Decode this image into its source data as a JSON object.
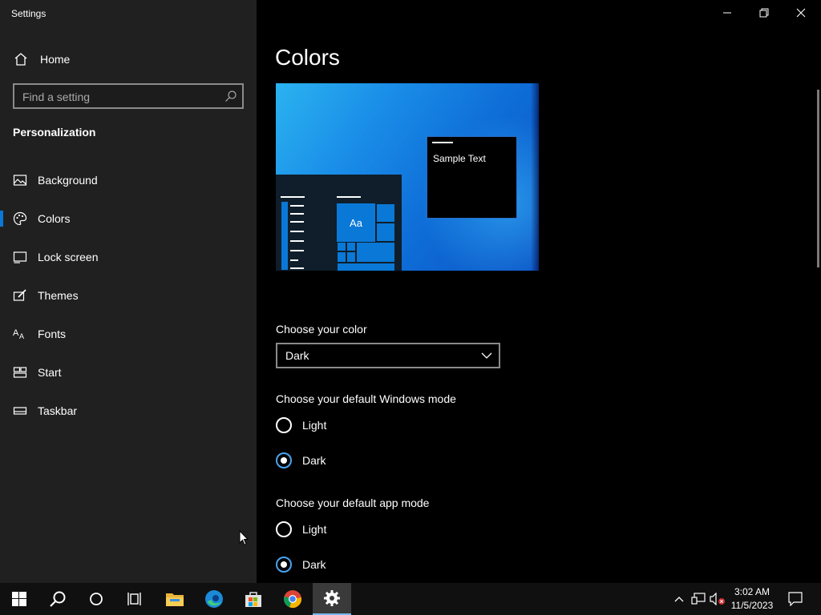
{
  "app": {
    "title": "Settings"
  },
  "sidebar": {
    "home_label": "Home",
    "search_placeholder": "Find a setting",
    "section_title": "Personalization",
    "items": [
      {
        "label": "Background",
        "icon": "image-icon"
      },
      {
        "label": "Colors",
        "icon": "palette-icon",
        "selected": true
      },
      {
        "label": "Lock screen",
        "icon": "lock-screen-icon"
      },
      {
        "label": "Themes",
        "icon": "brush-icon"
      },
      {
        "label": "Fonts",
        "icon": "font-icon"
      },
      {
        "label": "Start",
        "icon": "start-icon"
      },
      {
        "label": "Taskbar",
        "icon": "taskbar-icon"
      }
    ]
  },
  "main": {
    "title": "Colors",
    "preview": {
      "sample_text": "Sample Text",
      "tile_text": "Aa"
    },
    "choose_color": {
      "label": "Choose your color",
      "value": "Dark"
    },
    "windows_mode": {
      "label": "Choose your default Windows mode",
      "options": [
        {
          "label": "Light",
          "checked": false
        },
        {
          "label": "Dark",
          "checked": true
        }
      ]
    },
    "app_mode": {
      "label": "Choose your default app mode",
      "options": [
        {
          "label": "Light",
          "checked": false
        },
        {
          "label": "Dark",
          "checked": true
        }
      ]
    }
  },
  "taskbar": {
    "apps": [
      "start-icon",
      "search-icon",
      "cortana-icon",
      "task-view-icon",
      "file-explorer-icon",
      "edge-icon",
      "store-icon",
      "chrome-icon",
      "settings-icon"
    ],
    "clock": {
      "time": "3:02 AM",
      "date": "11/5/2023"
    }
  },
  "colors": {
    "accent": "#0a78d7",
    "sidebar_bg": "#202020",
    "main_bg": "#000000",
    "taskbar_bg": "#101010"
  }
}
